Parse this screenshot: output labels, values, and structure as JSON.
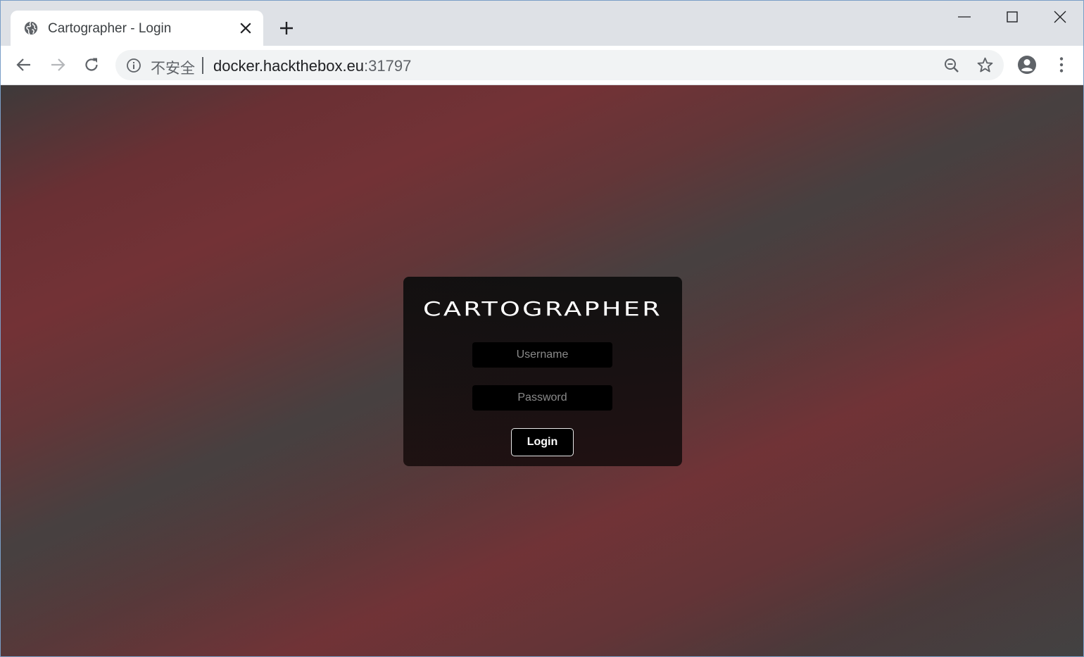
{
  "browser": {
    "tab": {
      "title": "Cartographer - Login",
      "favicon": "globe-icon"
    },
    "new_tab_icon": "plus-icon",
    "window_controls": [
      "minimize-icon",
      "maximize-icon",
      "close-icon"
    ],
    "toolbar": {
      "back_icon": "back-arrow-icon",
      "forward_icon": "forward-arrow-icon",
      "reload_icon": "reload-icon",
      "profile_icon": "account-circle-icon",
      "menu_icon": "kebab-menu-icon"
    },
    "omnibox": {
      "security_label": "不安全",
      "host": "docker.hackthebox.eu",
      "port": ":31797",
      "info_icon": "info-icon",
      "zoom_icon": "zoom-out-icon",
      "bookmark_icon": "star-icon"
    }
  },
  "page": {
    "logo_text": "CARTOGRAPHER",
    "username": {
      "placeholder": "Username",
      "value": ""
    },
    "password": {
      "placeholder": "Password",
      "value": ""
    },
    "login_label": "Login",
    "colors": {
      "background_dark": "#424242",
      "background_accent": "#733236",
      "card": "#121010",
      "field": "#000000",
      "text": "#ffffff"
    }
  }
}
